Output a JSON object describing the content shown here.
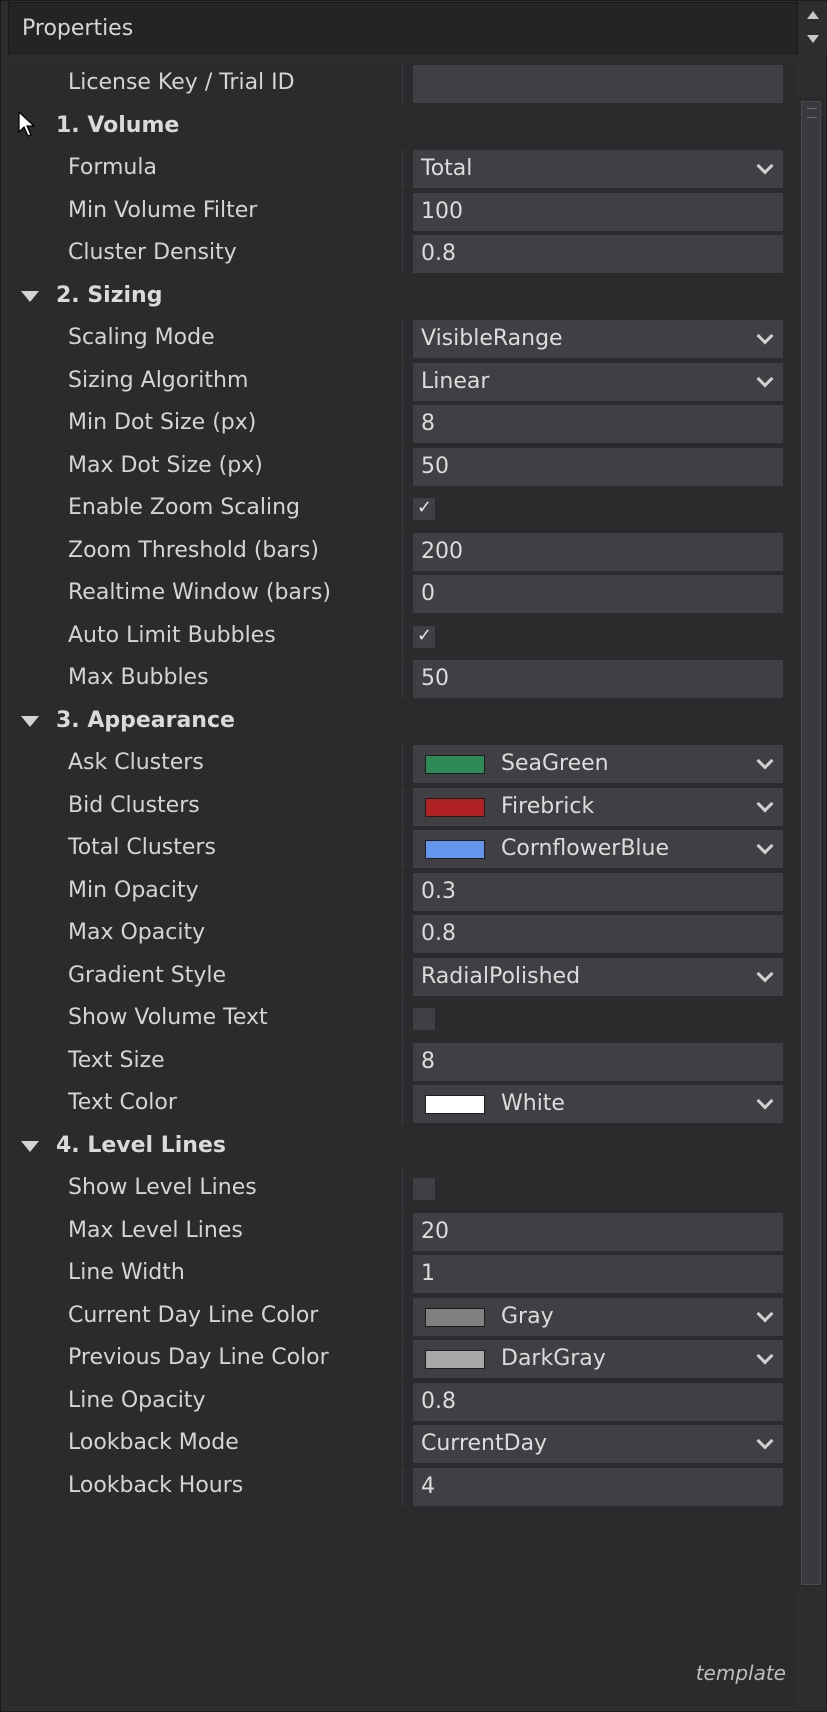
{
  "panel": {
    "title": "Properties",
    "footer": "template"
  },
  "rows": [
    {
      "kind": "prop",
      "label": "License Key / Trial ID",
      "value": "",
      "editor": "text"
    },
    {
      "kind": "cat",
      "label": "1. Volume",
      "collapsed": true
    },
    {
      "kind": "prop",
      "label": "Formula",
      "value": "Total",
      "editor": "dropdown"
    },
    {
      "kind": "prop",
      "label": "Min Volume Filter",
      "value": "100",
      "editor": "text"
    },
    {
      "kind": "prop",
      "label": "Cluster Density",
      "value": "0.8",
      "editor": "text"
    },
    {
      "kind": "cat",
      "label": "2. Sizing",
      "collapsed": false
    },
    {
      "kind": "prop",
      "label": "Scaling Mode",
      "value": "VisibleRange",
      "editor": "dropdown"
    },
    {
      "kind": "prop",
      "label": "Sizing Algorithm",
      "value": "Linear",
      "editor": "dropdown"
    },
    {
      "kind": "prop",
      "label": "Min Dot Size (px)",
      "value": "8",
      "editor": "text"
    },
    {
      "kind": "prop",
      "label": "Max Dot Size (px)",
      "value": "50",
      "editor": "text"
    },
    {
      "kind": "prop",
      "label": "Enable Zoom Scaling",
      "checked": true,
      "editor": "checkbox"
    },
    {
      "kind": "prop",
      "label": "Zoom Threshold (bars)",
      "value": "200",
      "editor": "text"
    },
    {
      "kind": "prop",
      "label": "Realtime Window (bars)",
      "value": "0",
      "editor": "text"
    },
    {
      "kind": "prop",
      "label": "Auto Limit Bubbles",
      "checked": true,
      "editor": "checkbox"
    },
    {
      "kind": "prop",
      "label": "Max Bubbles",
      "value": "50",
      "editor": "text"
    },
    {
      "kind": "cat",
      "label": "3. Appearance",
      "collapsed": false
    },
    {
      "kind": "prop",
      "label": "Ask Clusters",
      "value": "SeaGreen",
      "color": "#2e8b57",
      "editor": "color"
    },
    {
      "kind": "prop",
      "label": "Bid Clusters",
      "value": "Firebrick",
      "color": "#b22222",
      "editor": "color"
    },
    {
      "kind": "prop",
      "label": "Total Clusters",
      "value": "CornflowerBlue",
      "color": "#6495ed",
      "editor": "color"
    },
    {
      "kind": "prop",
      "label": "Min Opacity",
      "value": "0.3",
      "editor": "text"
    },
    {
      "kind": "prop",
      "label": "Max Opacity",
      "value": "0.8",
      "editor": "text"
    },
    {
      "kind": "prop",
      "label": "Gradient Style",
      "value": "RadialPolished",
      "editor": "dropdown"
    },
    {
      "kind": "prop",
      "label": "Show Volume Text",
      "checked": false,
      "editor": "checkbox"
    },
    {
      "kind": "prop",
      "label": "Text Size",
      "value": "8",
      "editor": "text"
    },
    {
      "kind": "prop",
      "label": "Text Color",
      "value": "White",
      "color": "#ffffff",
      "editor": "color"
    },
    {
      "kind": "cat",
      "label": "4. Level Lines",
      "collapsed": false
    },
    {
      "kind": "prop",
      "label": "Show Level Lines",
      "checked": false,
      "editor": "checkbox"
    },
    {
      "kind": "prop",
      "label": "Max Level Lines",
      "value": "20",
      "editor": "text"
    },
    {
      "kind": "prop",
      "label": "Line Width",
      "value": "1",
      "editor": "text"
    },
    {
      "kind": "prop",
      "label": "Current Day Line Color",
      "value": "Gray",
      "color": "#808080",
      "editor": "color"
    },
    {
      "kind": "prop",
      "label": "Previous Day Line Color",
      "value": "DarkGray",
      "color": "#a9a9a9",
      "editor": "color"
    },
    {
      "kind": "prop",
      "label": "Line Opacity",
      "value": "0.8",
      "editor": "text"
    },
    {
      "kind": "prop",
      "label": "Lookback Mode",
      "value": "CurrentDay",
      "editor": "dropdown"
    },
    {
      "kind": "prop",
      "label": "Lookback Hours",
      "value": "4",
      "editor": "text"
    }
  ]
}
